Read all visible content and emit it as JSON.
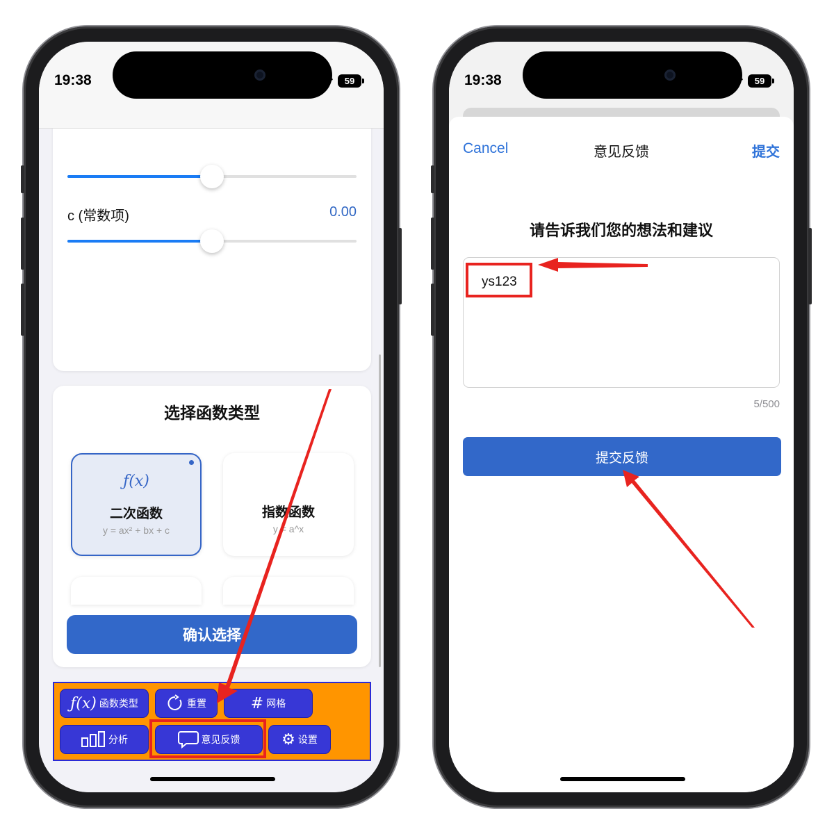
{
  "left_phone": {
    "status": {
      "time": "19:38",
      "battery": "59"
    },
    "sliders": [
      {
        "label": "c (常数项)",
        "value": "0.00",
        "fraction": 0.5
      }
    ],
    "function_picker": {
      "title": "选择函数类型",
      "cards": [
        {
          "icon": "ƒ(x)",
          "name": "二次函数",
          "formula": "y = ax² + bx + c",
          "selected": true
        },
        {
          "icon": "",
          "name": "指数函数",
          "formula": "y = a^x",
          "selected": false
        }
      ],
      "confirm_label": "确认选择"
    },
    "toolbar": {
      "function_type": {
        "icon": "function-icon",
        "label": "函数类型"
      },
      "reset": {
        "icon": "rotate-icon",
        "label": "重置"
      },
      "grid": {
        "icon": "grid-icon",
        "label": "网格"
      },
      "analysis": {
        "icon": "bar-chart-icon",
        "label": "分析"
      },
      "feedback": {
        "icon": "chat-bubble-icon",
        "label": "意见反馈"
      },
      "settings": {
        "icon": "gear-icon",
        "label": "设置"
      }
    }
  },
  "right_phone": {
    "status": {
      "time": "19:38",
      "battery": "59"
    },
    "nav": {
      "cancel": "Cancel",
      "title": "意见反馈",
      "submit": "提交"
    },
    "prompt": "请告诉我们您的想法和建议",
    "feedback_input": {
      "value": "ys123"
    },
    "counter": "5/500",
    "submit_button": "提交反馈"
  },
  "colors": {
    "accent": "#3268c9",
    "link": "#2f73d9",
    "toolbar_bg": "#ff9500",
    "toolbar_button": "#3737d6",
    "annotation_red": "#e8231f"
  }
}
